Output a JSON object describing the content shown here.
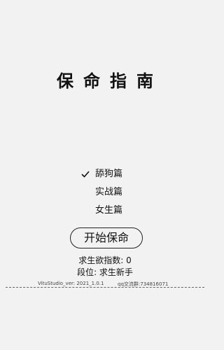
{
  "title": "保命指南",
  "menu": {
    "items": [
      {
        "label": "舔狗篇",
        "selected": true
      },
      {
        "label": "实战篇",
        "selected": false
      },
      {
        "label": "女生篇",
        "selected": false
      }
    ],
    "check_icon": "checkmark-icon"
  },
  "start_button": {
    "label": "开始保命"
  },
  "stats": {
    "survival_index": "求生欲指数: 0",
    "rank": "段位: 求生新手"
  },
  "footer": {
    "version": "VituStudio_ver: 2021_1.0.1",
    "qq_group": "qq交流群:734816071"
  }
}
